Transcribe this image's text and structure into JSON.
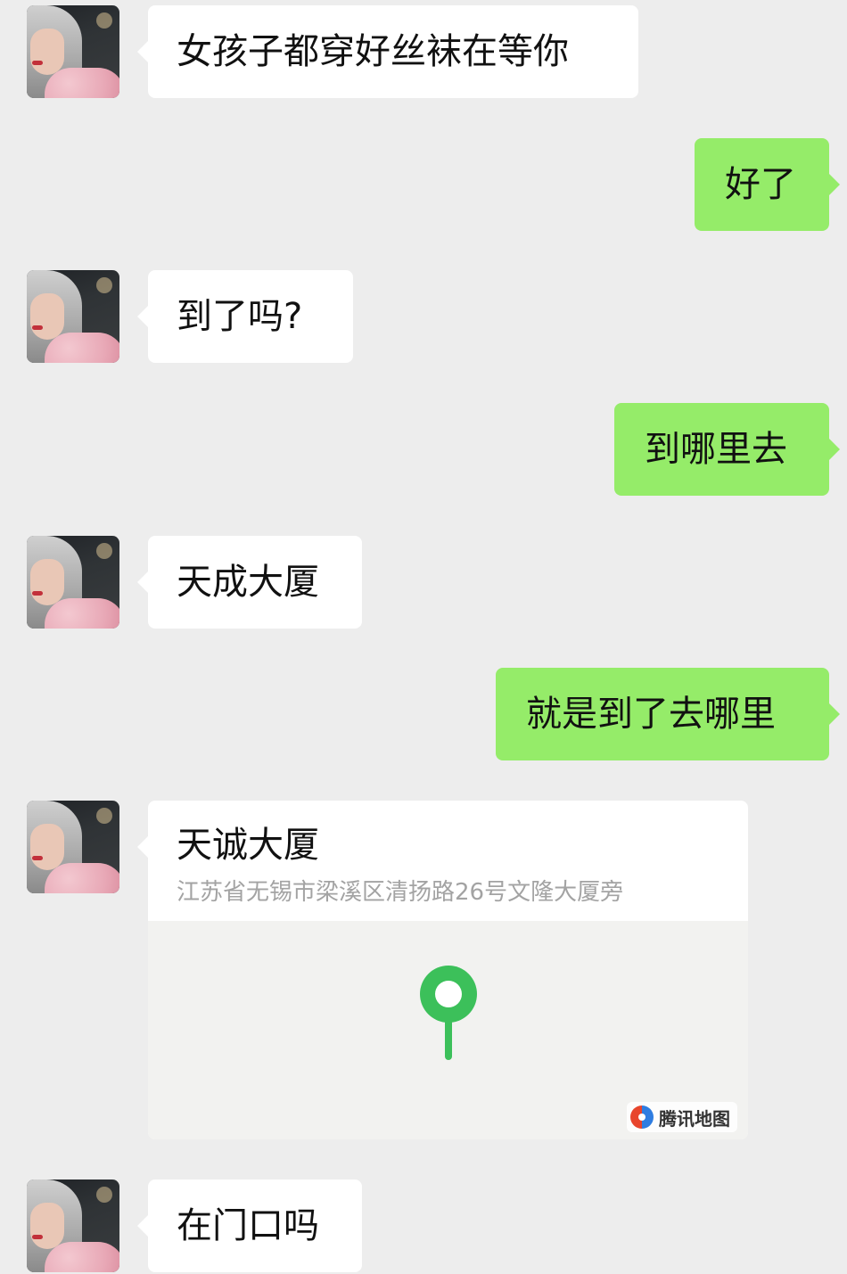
{
  "messages": [
    {
      "side": "left",
      "text": "女孩子都穿好丝袜在等你"
    },
    {
      "side": "right",
      "text": "好了"
    },
    {
      "side": "left",
      "text": "到了吗?"
    },
    {
      "side": "right",
      "text": "到哪里去"
    },
    {
      "side": "left",
      "text": "天成大厦"
    },
    {
      "side": "right",
      "text": "就是到了去哪里"
    },
    {
      "side": "left",
      "type": "location",
      "title": "天诚大厦",
      "address": "江苏省无锡市梁溪区清扬路26号文隆大厦旁",
      "map_brand": "腾讯地图"
    },
    {
      "side": "left",
      "text": "在门口吗"
    }
  ],
  "colors": {
    "background": "#ededed",
    "incoming_bubble": "#ffffff",
    "outgoing_bubble": "#95ec69",
    "pin": "#3cc05a"
  }
}
